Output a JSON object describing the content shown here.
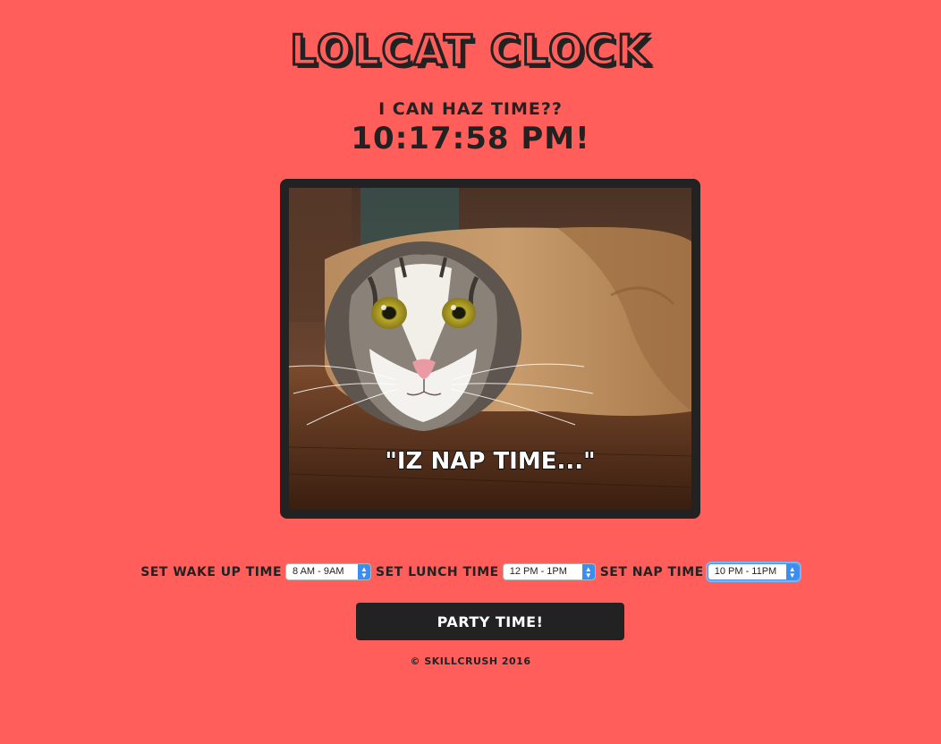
{
  "header": {
    "title": "Lolcat Clock",
    "subtitle": "I can haz time??",
    "clock": "10:17:58 PM!"
  },
  "image": {
    "caption": "\"IZ NAP TIME...\""
  },
  "controls": {
    "wake": {
      "label": "Set wake up time",
      "selected": "8 AM - 9AM"
    },
    "lunch": {
      "label": "Set lunch time",
      "selected": "12 PM - 1PM"
    },
    "nap": {
      "label": "Set nap time",
      "selected": "10 PM - 11PM"
    }
  },
  "button": {
    "label": "Party Time!"
  },
  "footer": {
    "text": "© Skillcrush 2016"
  },
  "colors": {
    "background": "#ff5e5a",
    "text": "#222222",
    "button_bg": "#222222",
    "button_text": "#ffffff",
    "select_accent": "#3a8ef0"
  }
}
